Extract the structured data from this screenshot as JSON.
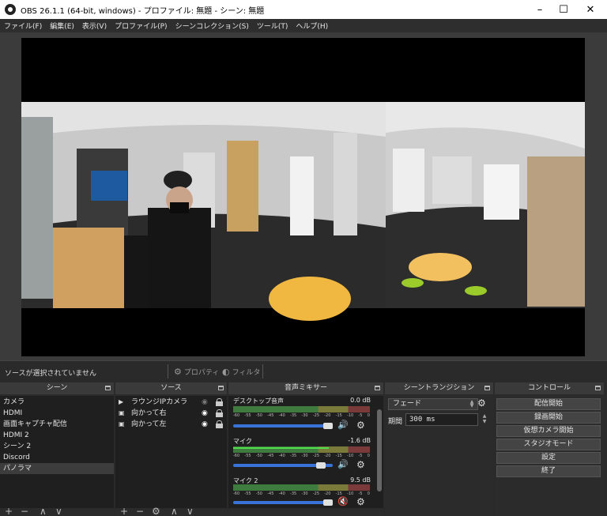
{
  "window": {
    "title": "OBS 26.1.1 (64-bit, windows) - プロファイル: 無題 - シーン: 無題",
    "minimize_icon": "–",
    "maximize_icon": "☐",
    "close_icon": "✕"
  },
  "menu": [
    "ファイル(F)",
    "編集(E)",
    "表示(V)",
    "プロファイル(P)",
    "シーンコレクション(S)",
    "ツール(T)",
    "ヘルプ(H)"
  ],
  "status": {
    "no_source": "ソースが選択されていません",
    "properties": "プロパティ",
    "filters": "フィルタ"
  },
  "scenes": {
    "title": "シーン",
    "items": [
      "カメラ",
      "HDMI",
      "画面キャプチャ配信",
      "HDMI 2",
      "シーン 2",
      "Discord",
      "パノラマ"
    ],
    "selected_index": 6
  },
  "sources": {
    "title": "ソース",
    "items": [
      {
        "label": "ラウンジIPカメラ",
        "visible": false
      },
      {
        "label": "向かって右",
        "visible": true
      },
      {
        "label": "向かって左",
        "visible": true
      }
    ]
  },
  "mixer": {
    "title": "音声ミキサー",
    "ticks": [
      "-60",
      "-55",
      "-50",
      "-45",
      "-40",
      "-35",
      "-30",
      "-25",
      "-20",
      "-15",
      "-10",
      "-5",
      "0"
    ],
    "channels": [
      {
        "name": "デスクトップ音声",
        "db": "0.0 dB",
        "level": 0.0,
        "fader": 0.95,
        "muted": false
      },
      {
        "name": "マイク",
        "db": "-1.6 dB",
        "level": 0.7,
        "fader": 0.88,
        "muted": false
      },
      {
        "name": "マイク 2",
        "db": "9.5 dB",
        "level": 0.0,
        "fader": 0.95,
        "muted": true
      }
    ]
  },
  "transitions": {
    "title": "シーントランジション",
    "selected": "フェード",
    "duration_label": "期間",
    "duration_value": "300 ms"
  },
  "controls": {
    "title": "コントロール",
    "buttons": [
      "配信開始",
      "録画開始",
      "仮想カメラ開始",
      "スタジオモード",
      "設定",
      "終了"
    ]
  },
  "colors": {
    "fader_blue": "#3a73d8",
    "meter_green": "#4fdc4f",
    "mute_red": "#e03030"
  }
}
